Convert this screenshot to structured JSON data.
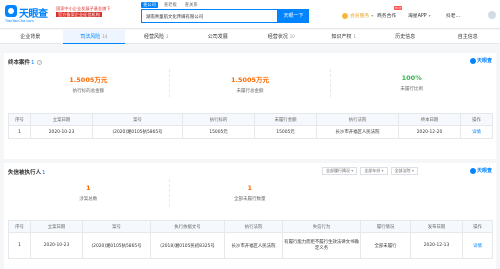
{
  "header": {
    "logo_name": "天眼查",
    "logo_sub": "TianYanCha.com",
    "banner_line1": "国家中小企业发展子基金旗下",
    "banner_line2": "官方备案企业征信机构",
    "search_tabs": [
      "查公司",
      "查老板",
      "查关系"
    ],
    "search_value": "湖南青童航文化传媒有限公司",
    "search_button": "天眼一下",
    "nav_vip": "会员服务",
    "nav_biz": "商务合作",
    "hot_badge": "HOT",
    "nav_app": "海星APP",
    "nav_user": "抖老..."
  },
  "tabs": [
    {
      "label": "企业背景",
      "count": ""
    },
    {
      "label": "司法风险",
      "count": "14"
    },
    {
      "label": "经营风险",
      "count": "2"
    },
    {
      "label": "公司发展",
      "count": ""
    },
    {
      "label": "经营状况",
      "count": "10"
    },
    {
      "label": "知识产权",
      "count": "1"
    },
    {
      "label": "历史信息",
      "count": ""
    },
    {
      "label": "自主信息",
      "count": ""
    }
  ],
  "section1": {
    "title": "终本案件",
    "count": "1",
    "brand": "天眼查",
    "stats": [
      {
        "value": "1.5005万元",
        "label": "执行标的总金额",
        "color": "#ff6a00"
      },
      {
        "value": "1.5005万元",
        "label": "未履行总金额",
        "color": "#ff6a00"
      },
      {
        "value": "100%",
        "label": "未履行比例",
        "color": "#32b44a"
      }
    ],
    "columns": [
      "序号",
      "立案日期",
      "案号",
      "执行标的",
      "未履行金额",
      "执行法院",
      "终本日期",
      "操作"
    ],
    "rows": [
      [
        "1",
        "2020-10-23",
        "(2020)湘0105执5865号",
        "15005元",
        "15005元",
        "长沙市开福区人民法院",
        "2020-12-20",
        "详情"
      ]
    ]
  },
  "section2": {
    "title": "失信被执行人",
    "count": "1",
    "filters": [
      "全部履行情况",
      "全部年份",
      "全部法院"
    ],
    "brand": "天眼查",
    "stats": [
      {
        "value": "1",
        "label": "涉案总数",
        "color": "#ff6a00"
      },
      {
        "value": "1",
        "label": "全部未履行数量",
        "color": "#ff6a00"
      }
    ],
    "columns": [
      "序号",
      "立案日期",
      "案号",
      "执行依据文号",
      "执行法院",
      "失信行为",
      "履行情况",
      "发布日期",
      "操作"
    ],
    "rows": [
      [
        "1",
        "2020-10-23",
        "(2020)湘0105执5865号",
        "(2018)湘0105民初8325号",
        "长沙市开福区人民法院",
        "有履行能力而拒不履行生效法律文书确定义务",
        "全部未履行",
        "2020-12-13",
        "详情"
      ]
    ]
  }
}
